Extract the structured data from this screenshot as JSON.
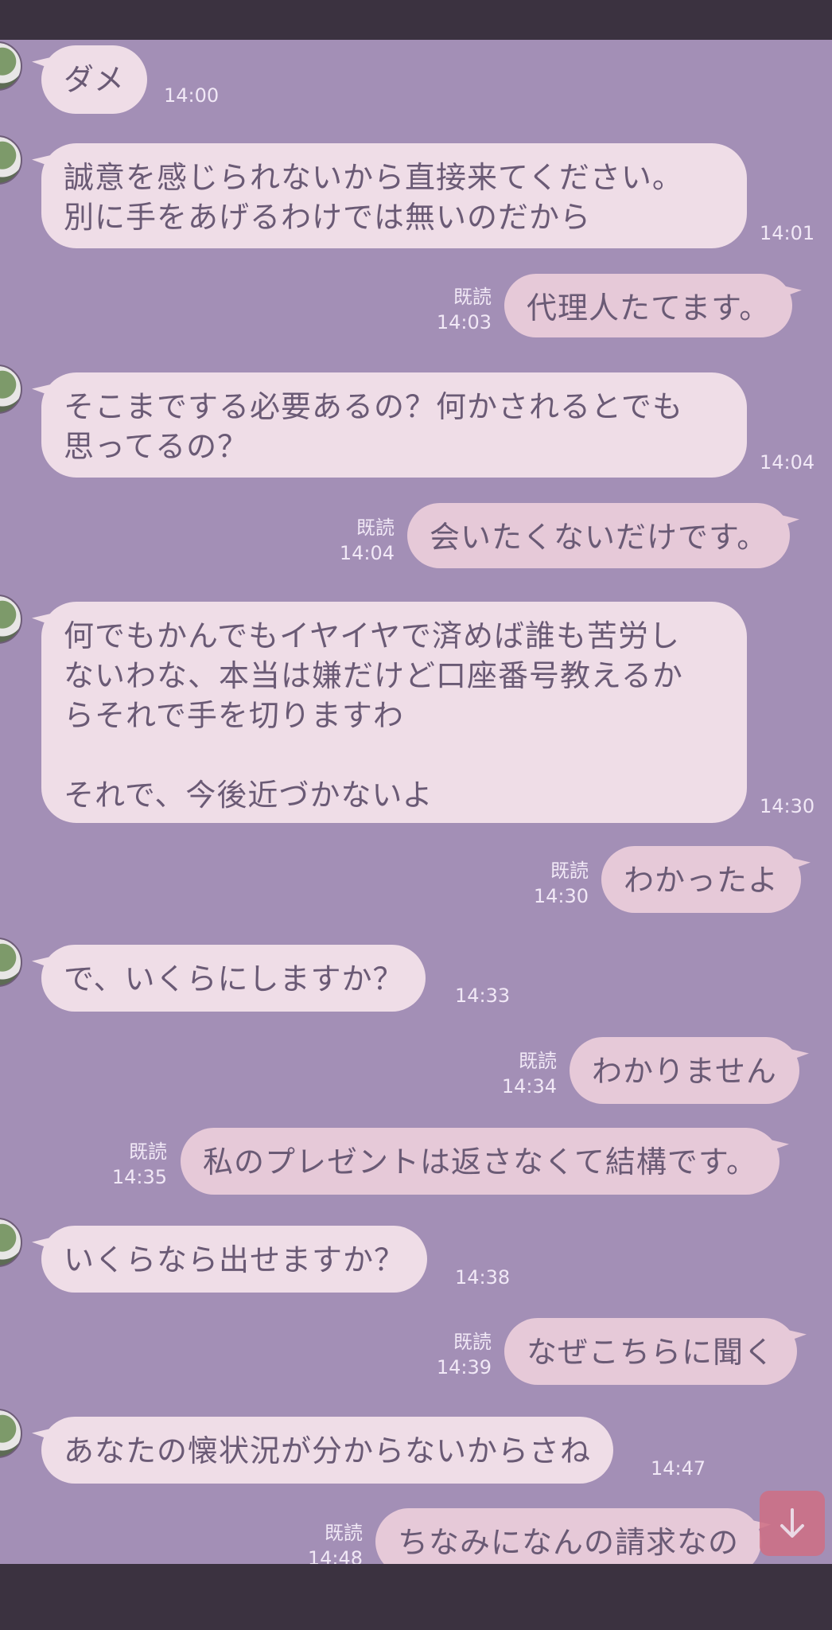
{
  "read_label": "既読",
  "scroll_icon": "arrow-down-icon",
  "messages": [
    {
      "text": "ダメ",
      "time": "14:00"
    },
    {
      "text": "誠意を感じられないから直接来てください。\n別に手をあげるわけでは無いのだから",
      "time": "14:01"
    },
    {
      "text": "代理人たてます。",
      "time": "14:03"
    },
    {
      "text": "そこまでする必要あるの？何かされるとでも\n思ってるの？",
      "time": "14:04"
    },
    {
      "text": "会いたくないだけです。",
      "time": "14:04"
    },
    {
      "text": "何でもかんでもイヤイヤで済めば誰も苦労し\nないわな、本当は嫌だけど口座番号教えるか\nらそれで手を切りますわ\n\nそれで、今後近づかないよ",
      "time": "14:30"
    },
    {
      "text": "わかったよ",
      "time": "14:30"
    },
    {
      "text": "で、いくらにしますか？",
      "time": "14:33"
    },
    {
      "text": "わかりません",
      "time": "14:34"
    },
    {
      "text": "私のプレゼントは返さなくて結構です。",
      "time": "14:35"
    },
    {
      "text": "いくらなら出せますか？",
      "time": "14:38"
    },
    {
      "text": "なぜこちらに聞く",
      "time": "14:39"
    },
    {
      "text": "あなたの懐状況が分からないからさね",
      "time": "14:47"
    },
    {
      "text": "ちなみになんの請求なの",
      "time": "14:48"
    }
  ]
}
